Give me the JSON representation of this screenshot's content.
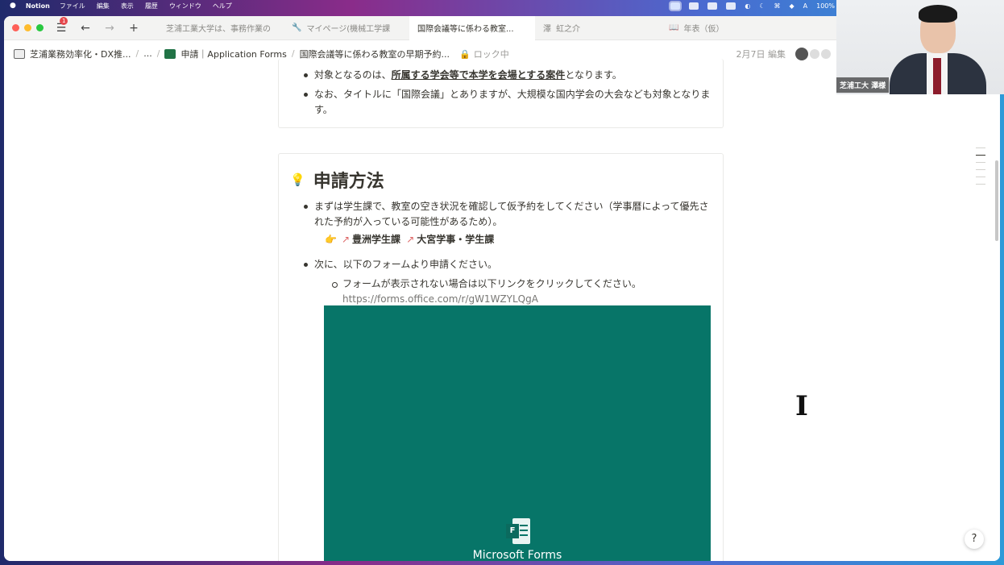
{
  "menubar": {
    "apple": "",
    "app_name": "Notion",
    "menus": [
      "ファイル",
      "編集",
      "表示",
      "履歴",
      "ウィンドウ",
      "ヘルプ"
    ],
    "battery": "100%"
  },
  "titlebar": {
    "notification_count": "1",
    "tabs": [
      {
        "icon": "",
        "label": "芝浦工業大学は、事務作業の"
      },
      {
        "icon": "🔧",
        "label": "マイページ(機械工学課"
      },
      {
        "icon": "",
        "label": "国際会議等に係わる教室..."
      },
      {
        "icon": "澤",
        "label": "虹之介"
      },
      {
        "icon": "📖",
        "label": "年表（仮）"
      }
    ]
  },
  "breadcrumb": {
    "workspace": "芝浦業務効率化・DX推...",
    "ellipsis": "...",
    "parent": "申請｜Application Forms",
    "current": "国際会議等に係わる教室の早期予約...",
    "lock": "ロック中",
    "edited": "2月7日 編集"
  },
  "section_intro": {
    "bullets": [
      {
        "prefix": "対象となるのは、",
        "bold": "所属する学会等で本学を会場とする案件",
        "suffix": "となります。"
      },
      {
        "text": "なお、タイトルに「国際会議」とありますが、大規模な国内学会の大会なども対象となります。"
      }
    ]
  },
  "section_apply": {
    "title": "申請方法",
    "step1": "まずは学生課で、教室の空き状況を確認して仮予約をしてください（学事暦によって優先された予約が入っている可能性があるため）。",
    "link1": "豊洲学生課",
    "link2": "大宮学事・学生課",
    "step2": "次に、以下のフォームより申請ください。",
    "sub_note": "フォームが表示されない場合は以下リンクをクリックしてください。",
    "url": "https://forms.office.com/r/gW1WZYLQgA",
    "embed_title": "Microsoft Forms",
    "embed_color": "#077568"
  },
  "video": {
    "name_label": "芝浦工大 澤様"
  },
  "help": "?"
}
